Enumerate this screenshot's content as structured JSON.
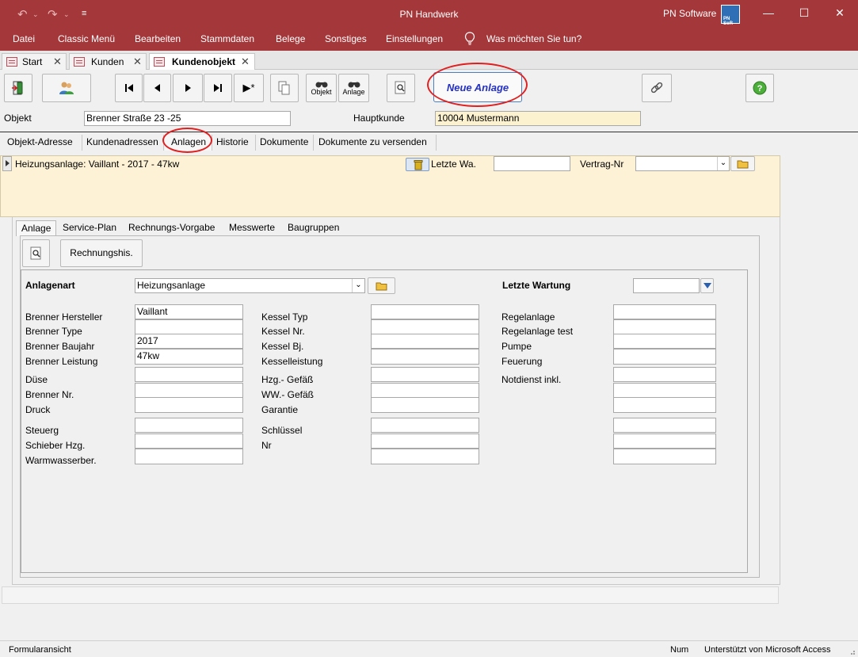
{
  "app": {
    "title": "PN Handwerk",
    "brand": "PN Software",
    "brand_logo_text": "PN SoR"
  },
  "menu": {
    "items": [
      "Datei",
      "Classic Menü",
      "Bearbeiten",
      "Stammdaten",
      "Belege",
      "Sonstiges",
      "Einstellungen"
    ],
    "tell_me": "Was möchten Sie tun?"
  },
  "doc_tabs": [
    {
      "label": "Start",
      "active": false
    },
    {
      "label": "Kunden",
      "active": false
    },
    {
      "label": "Kundenobjekt",
      "active": true
    }
  ],
  "toolbar": {
    "objekt_label": "Objekt",
    "anlage_label": "Anlage",
    "neue_anlage": "Neue Anlage",
    "last_symbol": "▶*"
  },
  "header": {
    "objekt_label": "Objekt",
    "objekt_value": "Brenner Straße 23 -25",
    "hauptkunde_label": "Hauptkunde",
    "hauptkunde_value": "10004 Mustermann"
  },
  "main_tabs": [
    {
      "label": "Objekt-Adresse",
      "active": false
    },
    {
      "label": "Kundenadressen",
      "active": false
    },
    {
      "label": "Anlagen",
      "active": true
    },
    {
      "label": "Historie",
      "active": false
    },
    {
      "label": "Dokumente",
      "active": false
    },
    {
      "label": "Dokumente zu versenden",
      "active": false
    }
  ],
  "record": {
    "title": "Heizungsanlage: Vaillant  - 2017 - 47kw",
    "letzte_wa_label": "Letzte Wa.",
    "letzte_wa_value": "",
    "vertrag_label": "Vertrag-Nr",
    "vertrag_value": ""
  },
  "sub_tabs": [
    {
      "label": "Anlage",
      "active": true
    },
    {
      "label": "Service-Plan",
      "active": false
    },
    {
      "label": "Rechnungs-Vorgabe",
      "active": false
    },
    {
      "label": "Messwerte",
      "active": false
    },
    {
      "label": "Baugruppen",
      "active": false
    }
  ],
  "anlage": {
    "rechnungshis_button": "Rechnungshis.",
    "anlagenart_label": "Anlagenart",
    "anlagenart_value": "Heizungsanlage",
    "letzte_wartung_label": "Letzte Wartung",
    "letzte_wartung_value": "",
    "col1": [
      {
        "label": "Brenner Hersteller",
        "value": "Vaillant"
      },
      {
        "label": "Brenner Type",
        "value": ""
      },
      {
        "label": "Brenner Baujahr",
        "value": "2017"
      },
      {
        "label": "Brenner Leistung",
        "value": "47kw"
      },
      {
        "label": "Düse",
        "value": ""
      },
      {
        "label": "Brenner Nr.",
        "value": ""
      },
      {
        "label": "Druck",
        "value": ""
      },
      {
        "label": "Steuerg",
        "value": ""
      },
      {
        "label": "Schieber Hzg.",
        "value": ""
      },
      {
        "label": "Warmwasserber.",
        "value": ""
      }
    ],
    "col2": [
      {
        "label": "Kessel Typ",
        "value": ""
      },
      {
        "label": "Kessel Nr.",
        "value": ""
      },
      {
        "label": "Kessel Bj.",
        "value": ""
      },
      {
        "label": "Kesselleistung",
        "value": ""
      },
      {
        "label": "Hzg.- Gefäß",
        "value": ""
      },
      {
        "label": "WW.- Gefäß",
        "value": ""
      },
      {
        "label": "Garantie",
        "value": ""
      },
      {
        "label": "Schlüssel",
        "value": ""
      },
      {
        "label": "Nr",
        "value": ""
      },
      {
        "label": "",
        "value": ""
      }
    ],
    "col3": [
      {
        "label": "Regelanlage",
        "value": ""
      },
      {
        "label": "Regelanlage test",
        "value": ""
      },
      {
        "label": "Pumpe",
        "value": ""
      },
      {
        "label": "Feuerung",
        "value": ""
      },
      {
        "label": "Notdienst inkl.",
        "value": ""
      },
      {
        "label": "",
        "value": ""
      },
      {
        "label": "",
        "value": ""
      },
      {
        "label": "",
        "value": ""
      },
      {
        "label": "",
        "value": ""
      },
      {
        "label": "",
        "value": ""
      }
    ]
  },
  "status": {
    "left": "Formularansicht",
    "num": "Num",
    "right": "Unterstützt von Microsoft Access"
  },
  "colors": {
    "accent": "#a4373a",
    "yellow_band": "#fdf2d5",
    "button_text": "#2431c4",
    "annotation": "#e02020"
  }
}
